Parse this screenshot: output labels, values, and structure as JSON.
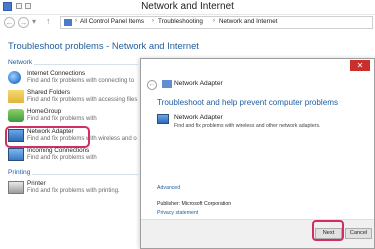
{
  "window": {
    "title": "Network and Internet"
  },
  "address_bar": {
    "crumbs": [
      "All Control Panel Items",
      "Troubleshooting",
      "Network and Internet"
    ]
  },
  "page": {
    "title": "Troubleshoot problems - Network and Internet",
    "sections": {
      "network": "Network",
      "printing": "Printing"
    },
    "items": [
      {
        "name": "Internet Connections",
        "desc": "Find and fix problems with connecting to",
        "icon": "globe-icon"
      },
      {
        "name": "Shared Folders",
        "desc": "Find and fix problems with accessing files",
        "icon": "folder-icon"
      },
      {
        "name": "HomeGroup",
        "desc": "Find and fix problems with",
        "icon": "homegroup-icon"
      },
      {
        "name": "Network Adapter",
        "desc": "Find and fix problems with wireless and o",
        "icon": "network-adapter-icon"
      },
      {
        "name": "Incoming Connections",
        "desc": "Find and fix problems with",
        "icon": "incoming-connections-icon"
      },
      {
        "name": "Printer",
        "desc": "Find and fix problems with printing.",
        "icon": "printer-icon"
      }
    ]
  },
  "dialog": {
    "title": "Network Adapter",
    "close_label": "✕",
    "heading": "Troubleshoot and help prevent computer problems",
    "item_name": "Network Adapter",
    "item_desc": "Find and fix problems with wireless and other network adapters.",
    "advanced": "Advanced",
    "publisher": "Publisher:   Microsoft Corporation",
    "privacy": "Privacy statement",
    "next": "Next",
    "cancel": "Cancel"
  },
  "colors": {
    "highlight": "#d12f62",
    "link": "#1e5c9e",
    "close": "#c9302c"
  }
}
